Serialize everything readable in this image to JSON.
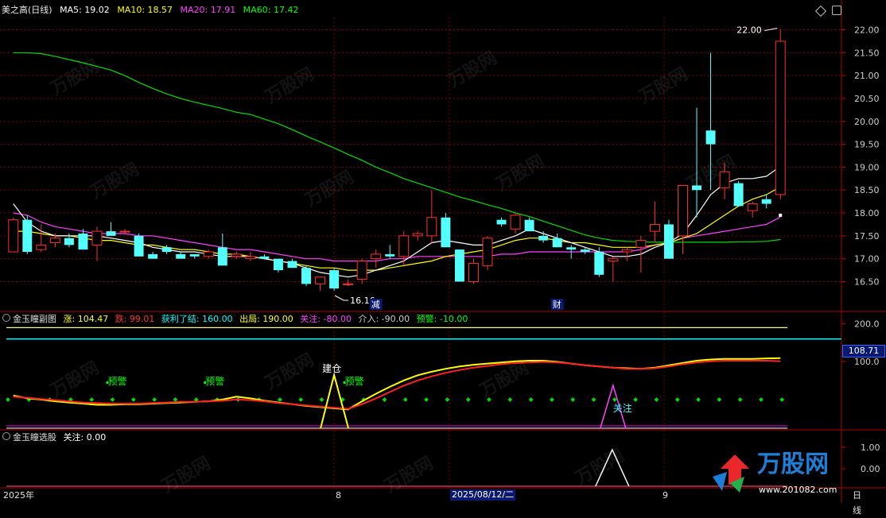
{
  "main": {
    "stock_name": "美之高(日线)",
    "ma_labels": [
      {
        "name": "MA5",
        "text": "MA5: 19.02",
        "color": "#ffffff"
      },
      {
        "name": "MA10",
        "text": "MA10: 18.57",
        "color": "#ffff00"
      },
      {
        "name": "MA20",
        "text": "MA20: 17.91",
        "color": "#ff40ff"
      },
      {
        "name": "MA60",
        "text": "MA60: 17.42",
        "color": "#00ff00"
      }
    ],
    "high_label": "22.00",
    "low_label": "16.16",
    "event_labels": [
      "减",
      "财"
    ]
  },
  "indicator1": {
    "title": "金玉瞳副图",
    "params": [
      {
        "text": "涨: 104.47",
        "color": "#ffff00"
      },
      {
        "text": "跌: 99.01",
        "color": "#ff3030"
      },
      {
        "text": "获利了结: 160.00",
        "color": "#00ffff"
      },
      {
        "text": "出局: 190.00",
        "color": "#ffff00"
      },
      {
        "text": "关注: -80.00",
        "color": "#ff40ff"
      },
      {
        "text": "介入: -90.00",
        "color": "#cccccc"
      },
      {
        "text": "预警: -10.00",
        "color": "#00ff00"
      }
    ],
    "current_value": "108.71",
    "annotations": {
      "warn": "预警",
      "build": "建仓",
      "focus": "关注"
    }
  },
  "indicator2": {
    "title": "金玉瞳选股",
    "params": [
      {
        "text": "关注: 0.00",
        "color": "#ffffff"
      }
    ]
  },
  "axes": {
    "price_ticks": [
      "22.00",
      "21.50",
      "21.00",
      "20.50",
      "20.00",
      "19.50",
      "19.00",
      "18.50",
      "18.00",
      "17.50",
      "17.00",
      "16.50"
    ],
    "ind1_ticks": [
      "200.0",
      "100.0"
    ],
    "ind2_ticks": [
      "1.00",
      "0.00"
    ],
    "date_labels": [
      "2025年",
      "8",
      "2025/08/12/二",
      "9"
    ],
    "period": "日线"
  },
  "watermark": {
    "brand": "万股网",
    "url": "www.201082.com"
  },
  "colors": {
    "up": "#ff3030",
    "down": "#54ffff",
    "grid": "#7a0000",
    "frame": "#b00000"
  },
  "chart_data": {
    "type": "candlestick",
    "ylim": [
      16.3,
      22.2
    ],
    "candles": [
      {
        "o": 17.15,
        "h": 17.9,
        "l": 17.15,
        "c": 17.85
      },
      {
        "o": 17.85,
        "h": 17.95,
        "l": 17.1,
        "c": 17.15
      },
      {
        "o": 17.2,
        "h": 17.75,
        "l": 17.15,
        "c": 17.3
      },
      {
        "o": 17.35,
        "h": 17.55,
        "l": 17.25,
        "c": 17.45
      },
      {
        "o": 17.45,
        "h": 17.55,
        "l": 17.25,
        "c": 17.3
      },
      {
        "o": 17.55,
        "h": 17.65,
        "l": 17.2,
        "c": 17.2
      },
      {
        "o": 17.3,
        "h": 17.7,
        "l": 16.95,
        "c": 17.6
      },
      {
        "o": 17.6,
        "h": 17.8,
        "l": 17.5,
        "c": 17.5
      },
      {
        "o": 17.6,
        "h": 17.65,
        "l": 17.55,
        "c": 17.6
      },
      {
        "o": 17.5,
        "h": 17.55,
        "l": 17.05,
        "c": 17.05
      },
      {
        "o": 17.1,
        "h": 17.15,
        "l": 17.0,
        "c": 17.0
      },
      {
        "o": 17.25,
        "h": 17.3,
        "l": 17.1,
        "c": 17.15
      },
      {
        "o": 17.1,
        "h": 17.15,
        "l": 17.0,
        "c": 17.0
      },
      {
        "o": 17.1,
        "h": 17.1,
        "l": 17.0,
        "c": 17.05
      },
      {
        "o": 17.05,
        "h": 17.2,
        "l": 17.0,
        "c": 17.15
      },
      {
        "o": 17.25,
        "h": 17.55,
        "l": 16.85,
        "c": 16.85
      },
      {
        "o": 17.05,
        "h": 17.15,
        "l": 17.0,
        "c": 17.1
      },
      {
        "o": 17.0,
        "h": 17.15,
        "l": 16.95,
        "c": 17.05
      },
      {
        "o": 17.05,
        "h": 17.1,
        "l": 17.0,
        "c": 17.0
      },
      {
        "o": 17.0,
        "h": 17.0,
        "l": 16.7,
        "c": 16.75
      },
      {
        "o": 16.95,
        "h": 17.0,
        "l": 16.8,
        "c": 16.8
      },
      {
        "o": 16.8,
        "h": 16.85,
        "l": 16.4,
        "c": 16.45
      },
      {
        "o": 16.45,
        "h": 16.55,
        "l": 16.3,
        "c": 16.6
      },
      {
        "o": 16.75,
        "h": 16.8,
        "l": 16.3,
        "c": 16.35
      },
      {
        "o": 16.45,
        "h": 16.55,
        "l": 16.4,
        "c": 16.45
      },
      {
        "o": 16.55,
        "h": 17.0,
        "l": 16.45,
        "c": 16.95
      },
      {
        "o": 17.0,
        "h": 17.2,
        "l": 16.8,
        "c": 17.1
      },
      {
        "o": 17.1,
        "h": 17.3,
        "l": 17.0,
        "c": 17.05
      },
      {
        "o": 17.05,
        "h": 17.6,
        "l": 16.85,
        "c": 17.5
      },
      {
        "o": 17.5,
        "h": 17.6,
        "l": 17.4,
        "c": 17.55
      },
      {
        "o": 17.5,
        "h": 18.5,
        "l": 17.35,
        "c": 17.9
      },
      {
        "o": 17.9,
        "h": 18.0,
        "l": 17.25,
        "c": 17.25
      },
      {
        "o": 17.2,
        "h": 17.2,
        "l": 16.5,
        "c": 16.5
      },
      {
        "o": 16.5,
        "h": 17.0,
        "l": 16.45,
        "c": 16.9
      },
      {
        "o": 16.85,
        "h": 17.5,
        "l": 16.75,
        "c": 17.45
      },
      {
        "o": 17.85,
        "h": 17.9,
        "l": 17.7,
        "c": 17.75
      },
      {
        "o": 17.65,
        "h": 18.0,
        "l": 17.55,
        "c": 17.95
      },
      {
        "o": 17.85,
        "h": 17.9,
        "l": 17.6,
        "c": 17.6
      },
      {
        "o": 17.5,
        "h": 17.6,
        "l": 17.35,
        "c": 17.4
      },
      {
        "o": 17.45,
        "h": 17.55,
        "l": 17.25,
        "c": 17.25
      },
      {
        "o": 17.25,
        "h": 17.3,
        "l": 17.0,
        "c": 17.2
      },
      {
        "o": 17.2,
        "h": 17.25,
        "l": 17.1,
        "c": 17.15
      },
      {
        "o": 17.15,
        "h": 17.25,
        "l": 16.6,
        "c": 16.65
      },
      {
        "o": 16.95,
        "h": 17.05,
        "l": 16.5,
        "c": 17.0
      },
      {
        "o": 17.15,
        "h": 17.25,
        "l": 16.95,
        "c": 17.2
      },
      {
        "o": 17.25,
        "h": 17.5,
        "l": 16.7,
        "c": 17.4
      },
      {
        "o": 17.6,
        "h": 18.25,
        "l": 17.35,
        "c": 17.75
      },
      {
        "o": 17.75,
        "h": 17.85,
        "l": 17.0,
        "c": 17.0
      },
      {
        "o": 17.5,
        "h": 18.6,
        "l": 17.1,
        "c": 18.6
      },
      {
        "o": 18.6,
        "h": 20.3,
        "l": 17.9,
        "c": 18.5
      },
      {
        "o": 19.8,
        "h": 21.5,
        "l": 18.5,
        "c": 19.5
      },
      {
        "o": 18.55,
        "h": 19.1,
        "l": 18.3,
        "c": 18.9
      },
      {
        "o": 18.65,
        "h": 18.7,
        "l": 18.15,
        "c": 18.15
      },
      {
        "o": 18.05,
        "h": 18.25,
        "l": 17.9,
        "c": 18.2
      },
      {
        "o": 18.3,
        "h": 18.4,
        "l": 18.1,
        "c": 18.2
      },
      {
        "o": 18.4,
        "h": 22.0,
        "l": 18.3,
        "c": 21.75
      }
    ],
    "ma5": [
      18.2,
      17.8,
      17.6,
      17.5,
      17.5,
      17.5,
      17.5,
      17.45,
      17.4,
      17.35,
      17.25,
      17.2,
      17.15,
      17.15,
      17.1,
      17.05,
      17.05,
      17.05,
      17.0,
      16.95,
      16.9,
      16.8,
      16.7,
      16.65,
      16.6,
      16.65,
      16.75,
      16.85,
      16.95,
      17.15,
      17.35,
      17.4,
      17.35,
      17.3,
      17.3,
      17.4,
      17.5,
      17.65,
      17.55,
      17.45,
      17.35,
      17.25,
      17.15,
      17.05,
      17.05,
      17.1,
      17.25,
      17.35,
      17.55,
      17.95,
      18.4,
      18.65,
      18.75,
      18.75,
      18.8,
      19.02
    ],
    "ma10": [
      17.6,
      17.6,
      17.55,
      17.5,
      17.5,
      17.45,
      17.4,
      17.4,
      17.35,
      17.3,
      17.3,
      17.25,
      17.2,
      17.2,
      17.15,
      17.1,
      17.1,
      17.05,
      17.0,
      16.95,
      16.9,
      16.85,
      16.8,
      16.8,
      16.75,
      16.75,
      16.75,
      16.8,
      16.85,
      16.9,
      16.95,
      17.05,
      17.1,
      17.15,
      17.2,
      17.3,
      17.4,
      17.45,
      17.45,
      17.4,
      17.35,
      17.35,
      17.3,
      17.25,
      17.25,
      17.25,
      17.3,
      17.35,
      17.45,
      17.55,
      17.75,
      17.95,
      18.15,
      18.3,
      18.4,
      18.57
    ],
    "ma20": [
      18.0,
      17.95,
      17.8,
      17.7,
      17.65,
      17.6,
      17.55,
      17.55,
      17.55,
      17.5,
      17.5,
      17.45,
      17.4,
      17.35,
      17.3,
      17.25,
      17.2,
      17.2,
      17.15,
      17.1,
      17.05,
      17.0,
      17.0,
      16.95,
      16.95,
      16.95,
      16.95,
      17.0,
      17.0,
      17.05,
      17.05,
      17.05,
      17.05,
      17.05,
      17.05,
      17.1,
      17.1,
      17.15,
      17.15,
      17.15,
      17.15,
      17.15,
      17.15,
      17.15,
      17.15,
      17.2,
      17.3,
      17.35,
      17.45,
      17.5,
      17.55,
      17.6,
      17.65,
      17.7,
      17.75,
      17.91
    ],
    "ma60": [
      21.5,
      21.5,
      21.48,
      21.42,
      21.35,
      21.28,
      21.2,
      21.12,
      21.0,
      20.85,
      20.72,
      20.6,
      20.5,
      20.42,
      20.35,
      20.28,
      20.2,
      20.15,
      20.05,
      19.95,
      19.82,
      19.68,
      19.55,
      19.42,
      19.28,
      19.15,
      19.0,
      18.88,
      18.75,
      18.65,
      18.55,
      18.45,
      18.35,
      18.27,
      18.18,
      18.1,
      18.0,
      17.92,
      17.82,
      17.72,
      17.62,
      17.52,
      17.45,
      17.4,
      17.38,
      17.37,
      17.36,
      17.36,
      17.36,
      17.36,
      17.36,
      17.36,
      17.37,
      17.37,
      17.38,
      17.42
    ],
    "indicator_yellow": [
      40,
      35,
      33,
      30,
      28,
      26,
      24,
      24,
      25,
      25,
      26,
      27,
      28,
      29,
      30,
      33,
      38,
      35,
      31,
      28,
      25,
      22,
      20,
      18,
      16,
      30,
      43,
      55,
      66,
      75,
      81,
      86,
      90,
      93,
      95,
      97,
      99,
      100,
      100,
      98,
      95,
      92,
      90,
      88,
      87,
      86,
      88,
      92,
      96,
      100,
      102,
      103,
      103,
      103,
      104,
      104.47
    ],
    "indicator_red": [
      38,
      36,
      34,
      32,
      30,
      28,
      27,
      26,
      26,
      26,
      27,
      28,
      29,
      29,
      30,
      31,
      33,
      32,
      30,
      27,
      25,
      23,
      21,
      19,
      17,
      25,
      35,
      46,
      57,
      66,
      73,
      79,
      84,
      88,
      91,
      94,
      96,
      97,
      98,
      97,
      95,
      92,
      90,
      88,
      86,
      86,
      87,
      90,
      94,
      97,
      99,
      100,
      100,
      100,
      100,
      99.01
    ],
    "indicator_cyan_level": 160.0,
    "indicator_yellow_level": 190.0
  }
}
